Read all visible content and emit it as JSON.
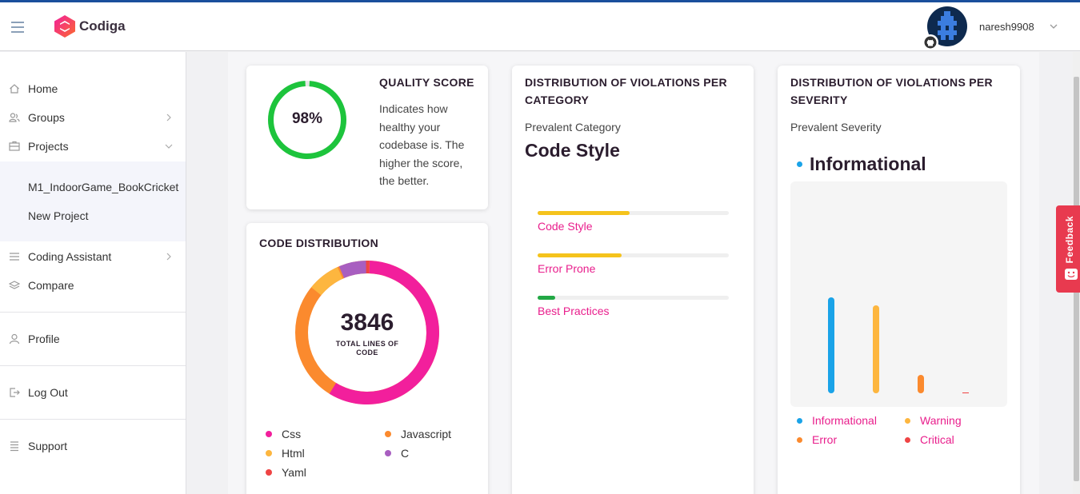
{
  "app": {
    "name": "Codiga"
  },
  "user": {
    "username": "naresh9908"
  },
  "sidebar": {
    "items": [
      {
        "label": "Home"
      },
      {
        "label": "Groups"
      },
      {
        "label": "Projects"
      },
      {
        "label": "Coding Assistant"
      },
      {
        "label": "Compare"
      },
      {
        "label": "Profile"
      },
      {
        "label": "Log Out"
      },
      {
        "label": "Support"
      }
    ],
    "projects": [
      {
        "label": "M1_IndoorGame_BookCricket"
      },
      {
        "label": "New Project"
      }
    ]
  },
  "quality": {
    "title": "QUALITY SCORE",
    "score": 98,
    "score_text": "98%",
    "description": "Indicates how healthy your codebase is. The higher the score, the better."
  },
  "code_distribution": {
    "title": "CODE DISTRIBUTION",
    "total": "3846",
    "total_label": "TOTAL LINES OF CODE",
    "legend": [
      {
        "label": "Css",
        "color": "#f21f9c"
      },
      {
        "label": "Javascript",
        "color": "#fb8a2e"
      },
      {
        "label": "Html",
        "color": "#fdb63f"
      },
      {
        "label": "C",
        "color": "#a85ec0"
      },
      {
        "label": "Yaml",
        "color": "#ef4444"
      }
    ]
  },
  "category": {
    "title": "DISTRIBUTION OF VIOLATIONS PER CATEGORY",
    "prevalent_label": "Prevalent Category",
    "prevalent_value": "Code Style",
    "bars": [
      {
        "label": "Code Style",
        "fraction": 0.48,
        "color": "#f5c31c"
      },
      {
        "label": "Error Prone",
        "fraction": 0.44,
        "color": "#f5c31c"
      },
      {
        "label": "Best Practices",
        "fraction": 0.09,
        "color": "#22a845"
      }
    ]
  },
  "severity": {
    "title": "DISTRIBUTION OF VIOLATIONS PER SEVERITY",
    "prevalent_label": "Prevalent Severity",
    "prevalent_value": "Informational",
    "legend": [
      {
        "label": "Informational",
        "color": "#1aa3e8"
      },
      {
        "label": "Warning",
        "color": "#fdb63f"
      },
      {
        "label": "Error",
        "color": "#fb8a2e"
      },
      {
        "label": "Critical",
        "color": "#ef4444"
      }
    ]
  },
  "chart_data": {
    "type": "bar",
    "title": "",
    "categories": [
      "Informational",
      "Warning",
      "Error",
      "Critical"
    ],
    "values": [
      100,
      92,
      19,
      1
    ],
    "colors": [
      "#1aa3e8",
      "#fdb63f",
      "#fb8a2e",
      "#ef4444"
    ]
  },
  "feedback": {
    "label": "Feedback"
  }
}
